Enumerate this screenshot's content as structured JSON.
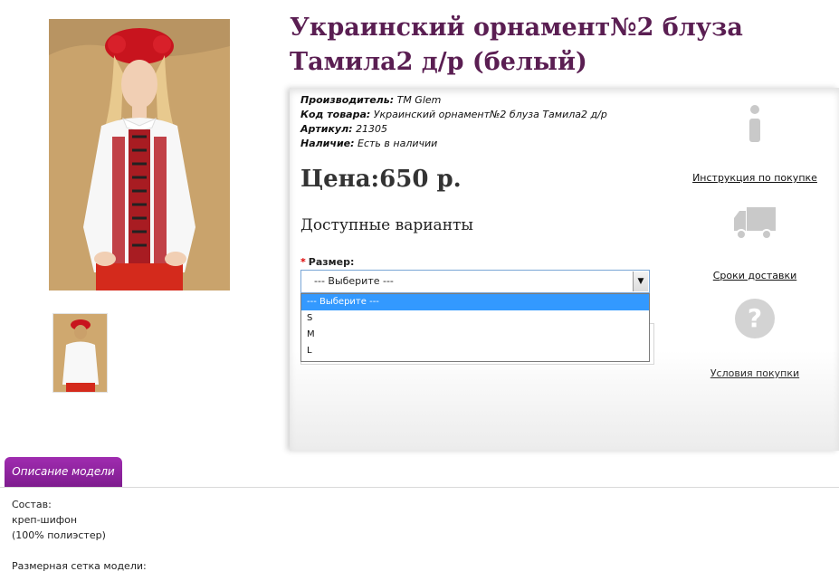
{
  "product": {
    "title": "Украинский орнамент№2 блуза Тамила2 д/р (белый)",
    "manufacturer_label": "Производитель:",
    "manufacturer_value": "ТМ Glem",
    "code_label": "Код товара:",
    "code_value": "Украинский орнамент№2 блуза Тамила2 д/р",
    "sku_label": "Артикул:",
    "sku_value": "21305",
    "stock_label": "Наличие:",
    "stock_value": "Есть в наличии",
    "price": "Цена:650 р."
  },
  "options": {
    "heading": "Доступные варианты",
    "size_label": "Размер:",
    "required_mark": "*",
    "select_value": "--- Выберите ---",
    "dropdown_options": [
      "--- Выберите ---",
      "S",
      "M",
      "L"
    ]
  },
  "sidebar": {
    "items": [
      {
        "label": "Инструкция по покупке",
        "icon": "info-icon"
      },
      {
        "label": "Сроки доставки",
        "icon": "truck-icon"
      },
      {
        "label": "Условия покупки",
        "icon": "question-icon"
      }
    ]
  },
  "tabs": {
    "description": "Описание модели"
  },
  "description": {
    "composition_label": "Состав:",
    "fabric": "креп-шифон",
    "fabric_detail": "(100% полиэстер)",
    "size_chart_label": "Размерная сетка модели:"
  },
  "colors": {
    "title": "#5a1e52",
    "tab": "#8e22a0",
    "dropdown_highlight": "#3399ff"
  }
}
